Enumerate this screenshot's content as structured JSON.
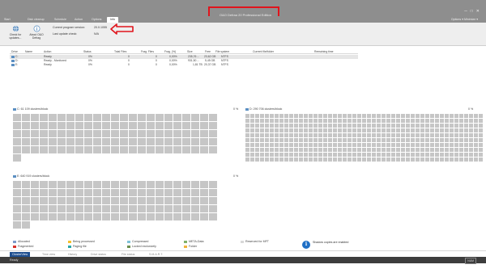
{
  "app": {
    "title": "O&O Defrag 20 Professional Edition",
    "window_controls": [
      "─",
      "□",
      "✕"
    ]
  },
  "tabs": {
    "items": [
      "Start",
      "Disk cleanup",
      "Schedule",
      "Action",
      "Options",
      "Info"
    ],
    "active": "Info",
    "right_label": "Options ▾ Minimize ▾"
  },
  "ribbon": {
    "buttons": [
      {
        "label_1": "Check for",
        "label_2": "updates...",
        "icon": "globe-icon"
      },
      {
        "label_1": "About O&O",
        "label_2": "Defrag",
        "icon": "info-icon"
      }
    ],
    "current_version_label": "Current program version:",
    "current_version_value": "20.0.1055",
    "last_update_label": "Last update check:",
    "last_update_value": "N/A"
  },
  "drive_table": {
    "columns": [
      "Drive",
      "Name",
      "Action",
      "Status",
      "Total Files",
      "Frag. Files",
      "Frag. (%)",
      "Size",
      "Free",
      "File system",
      "Current file/folder",
      "Remaining time"
    ],
    "rows": [
      {
        "drive": "C:",
        "name": "",
        "action": "Ready",
        "status": "0%",
        "total_files": "0",
        "frag_files": "0",
        "frag_pct": "0,00%",
        "size": "235,76 ...",
        "free": "23,62 GB",
        "fs": "NTFS",
        "current": "",
        "remaining": ""
      },
      {
        "drive": "D:",
        "name": "",
        "action": "Ready - Monitored",
        "status": "0%",
        "total_files": "0",
        "frag_files": "0",
        "frag_pct": "0,00%",
        "size": "931,50 ...",
        "free": "5,45 GB",
        "fs": "NTFS",
        "current": "",
        "remaining": ""
      },
      {
        "drive": "E:",
        "name": "",
        "action": "Ready",
        "status": "0%",
        "total_files": "0",
        "frag_files": "0",
        "frag_pct": "0,00%",
        "size": "1,81 TB",
        "free": "20,37 GB",
        "fs": "NTFS",
        "current": "",
        "remaining": ""
      }
    ]
  },
  "panels": {
    "c": {
      "title": "C: 61 109 clusters/block",
      "pct": "0 %"
    },
    "d": {
      "title": "D: 290 706 clusters/block",
      "pct": "0 %"
    },
    "e": {
      "title": "E: 640 919 clusters/block",
      "pct": "0 %"
    }
  },
  "legend": {
    "items": [
      {
        "label": "Allocated",
        "color": "#7b9ac9"
      },
      {
        "label": "Fragmented",
        "color": "#d7312a"
      },
      {
        "label": "Being processed",
        "color": "#f5c02b"
      },
      {
        "label": "Paging file",
        "color": "#2aa7a8"
      },
      {
        "label": "Compressed",
        "color": "#7fc2d8"
      },
      {
        "label": "Locked exclusively",
        "color": "#6b8e4e"
      },
      {
        "label": "META-Data",
        "color": "#7fb06a"
      },
      {
        "label": "Folder",
        "color": "#f0b23a"
      },
      {
        "label": "Reserved for MFT",
        "color": "#d8d8d8"
      }
    ],
    "shadow_note": "Shadow copies are enabled"
  },
  "bottom_tabs": {
    "items": [
      "ClusterView",
      "Time view",
      "History",
      "Drive status",
      "File status",
      "S.M.A.R.T."
    ],
    "active": "ClusterView"
  },
  "status": {
    "text": "Ready",
    "num": "NUM"
  },
  "colors": {
    "titlebar": "#8e8e8e",
    "highlight_box": "#e0141c",
    "block": "#c6c6c6",
    "accent": "#1f4f8f"
  }
}
